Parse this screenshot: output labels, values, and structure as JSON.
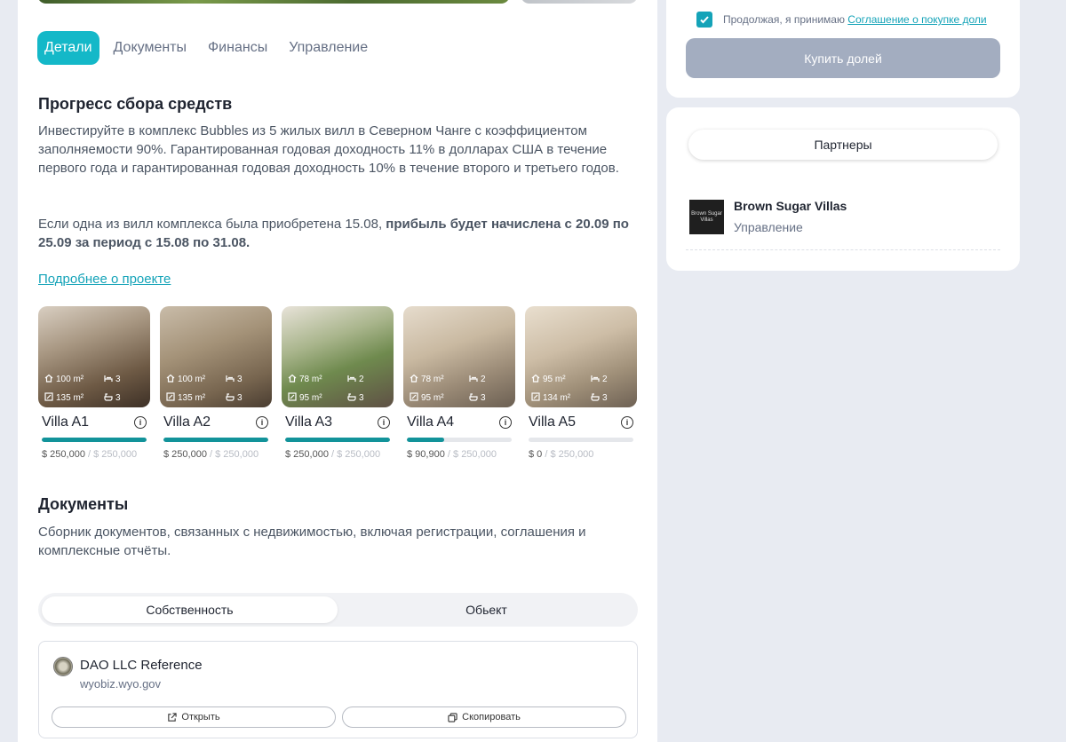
{
  "tabs": [
    {
      "label": "Детали"
    },
    {
      "label": "Документы"
    },
    {
      "label": "Финансы"
    },
    {
      "label": "Управление"
    }
  ],
  "progress_section": {
    "title": "Прогресс сбора средств",
    "paragraph1": "Инвестируйте в комплекс Bubbles из 5 жилых вилл в Северном Чанге с коэффициентом заполняемости 90%. Гарантированная годовая доходность 11% в долларах США в течение первого года и гарантированная годовая доходность 10% в течение второго и третьего годов.",
    "paragraph2_plain": "Если одна из вилл комплекса была приобретена 15.08, ",
    "paragraph2_bold": "прибыль будет начислена с 20.09 по 25.09 за период с 15.08 по 31.08.",
    "more_link": "Подробнее о проекте"
  },
  "villas": [
    {
      "name": "Villa A1",
      "area_top": "100 m²",
      "beds": "3",
      "area_bottom": "135 m²",
      "baths": "3",
      "raised": "$ 250,000",
      "goal": "$ 250,000",
      "progress": 1.0
    },
    {
      "name": "Villa A2",
      "area_top": "100 m²",
      "beds": "3",
      "area_bottom": "135 m²",
      "baths": "3",
      "raised": "$ 250,000",
      "goal": "$ 250,000",
      "progress": 1.0
    },
    {
      "name": "Villa A3",
      "area_top": "78 m²",
      "beds": "2",
      "area_bottom": "95 m²",
      "baths": "3",
      "raised": "$ 250,000",
      "goal": "$ 250,000",
      "progress": 1.0
    },
    {
      "name": "Villa A4",
      "area_top": "78 m²",
      "beds": "2",
      "area_bottom": "95 m²",
      "baths": "3",
      "raised": "$ 90,900",
      "goal": "$ 250,000",
      "progress": 0.36
    },
    {
      "name": "Villa A5",
      "area_top": "95 m²",
      "beds": "2",
      "area_bottom": "134 m²",
      "baths": "3",
      "raised": "$ 0",
      "goal": "$ 250,000",
      "progress": 0.0
    }
  ],
  "documents_section": {
    "title": "Документы",
    "description": "Сборник документов, связанных с недвижимостью, включая регистрации, соглашения и комплексные отчёты.",
    "segments": [
      "Собственность",
      "Обьект"
    ],
    "doc": {
      "title": "DAO LLC Reference",
      "url": "wyobiz.wyo.gov",
      "open_label": "Открыть",
      "copy_label": "Скопировать"
    }
  },
  "purchase": {
    "agree_text": "Продолжая, я принимаю ",
    "agree_link": "Соглашение о покупке доли",
    "buy_label": "Купить долей"
  },
  "partners": {
    "pill_label": "Партнеры",
    "partner_name": "Brown Sugar Villas",
    "partner_role": "Управление",
    "logo_line1": "Brown Sugar",
    "logo_line2": "Villas"
  },
  "colors": {
    "accent": "#14b8c8",
    "progress": "#12939a",
    "link": "#14a3b8",
    "buy_button_disabled": "#a3adc0"
  }
}
